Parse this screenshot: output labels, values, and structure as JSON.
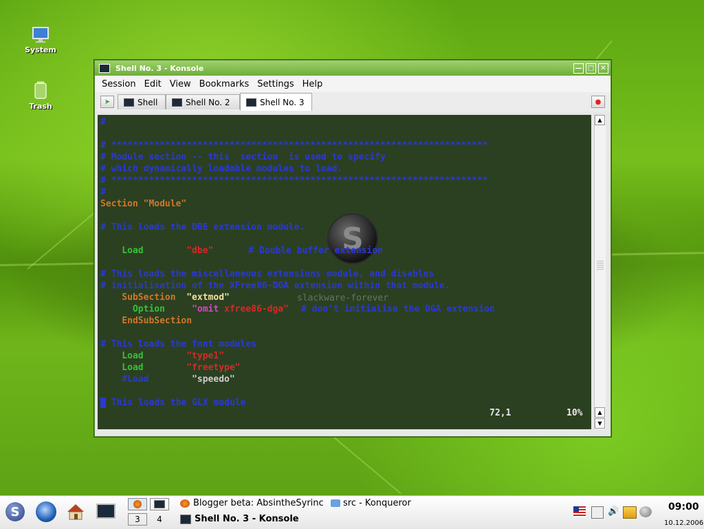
{
  "desktop": {
    "icons": [
      {
        "label": "System",
        "icon": "monitor-icon"
      },
      {
        "label": "Trash",
        "icon": "trash-icon"
      }
    ]
  },
  "window": {
    "title": "Shell No. 3 - Konsole",
    "menu": [
      "Session",
      "Edit",
      "View",
      "Bookmarks",
      "Settings",
      "Help"
    ],
    "tabs": [
      {
        "label": "Shell",
        "active": false
      },
      {
        "label": "Shell No. 2",
        "active": false
      },
      {
        "label": "Shell No. 3",
        "active": true
      }
    ]
  },
  "terminal": {
    "lines": [
      "#",
      "",
      "# **********************************************************************",
      "# Module section -- this  section  is used to specify",
      "# which dynamically loadable modules to load.",
      "# **********************************************************************",
      "#",
      "Section \"Module\"",
      "",
      "# This loads the DBE extension module.",
      "",
      "    Load        \"dbe\"",
      "    # Double buffer extension",
      "",
      "# This loads the miscellaneous extensions module, and disables",
      "# initialisation of the XFree86-DGA extension within that module.",
      "    SubSection  \"extmod\"",
      "      Option     \"omit",
      "xfree86-dga\"",
      "# don't initialise the DGA extension",
      "    EndSubSection",
      "",
      "# This loads the font modules",
      "    Load        \"type1\"",
      "    Load        \"freetype\"",
      "    #Load        \"speedo\"",
      "",
      " This loads the GLX module"
    ],
    "watermark_logo": "S",
    "watermark_text": "slackware-forever",
    "status_position": "72,1",
    "status_percent": "10%"
  },
  "taskbar": {
    "pager": [
      "3",
      "4"
    ],
    "tasks": [
      {
        "label": "Blogger beta: AbsintheSyrinc",
        "icon": "firefox-icon"
      },
      {
        "label": "src - Konqueror",
        "icon": "folder-icon"
      },
      {
        "label": "Shell No. 3 - Konsole",
        "icon": "konsole-icon",
        "active": true
      }
    ],
    "clock_time": "09:00",
    "clock_date": "10.12.2006."
  },
  "colors": {
    "comment": "#2a38d8",
    "section": "#d0772a",
    "keyword": "#38c038",
    "string": "#d82828",
    "titlebar": "#86c050"
  }
}
